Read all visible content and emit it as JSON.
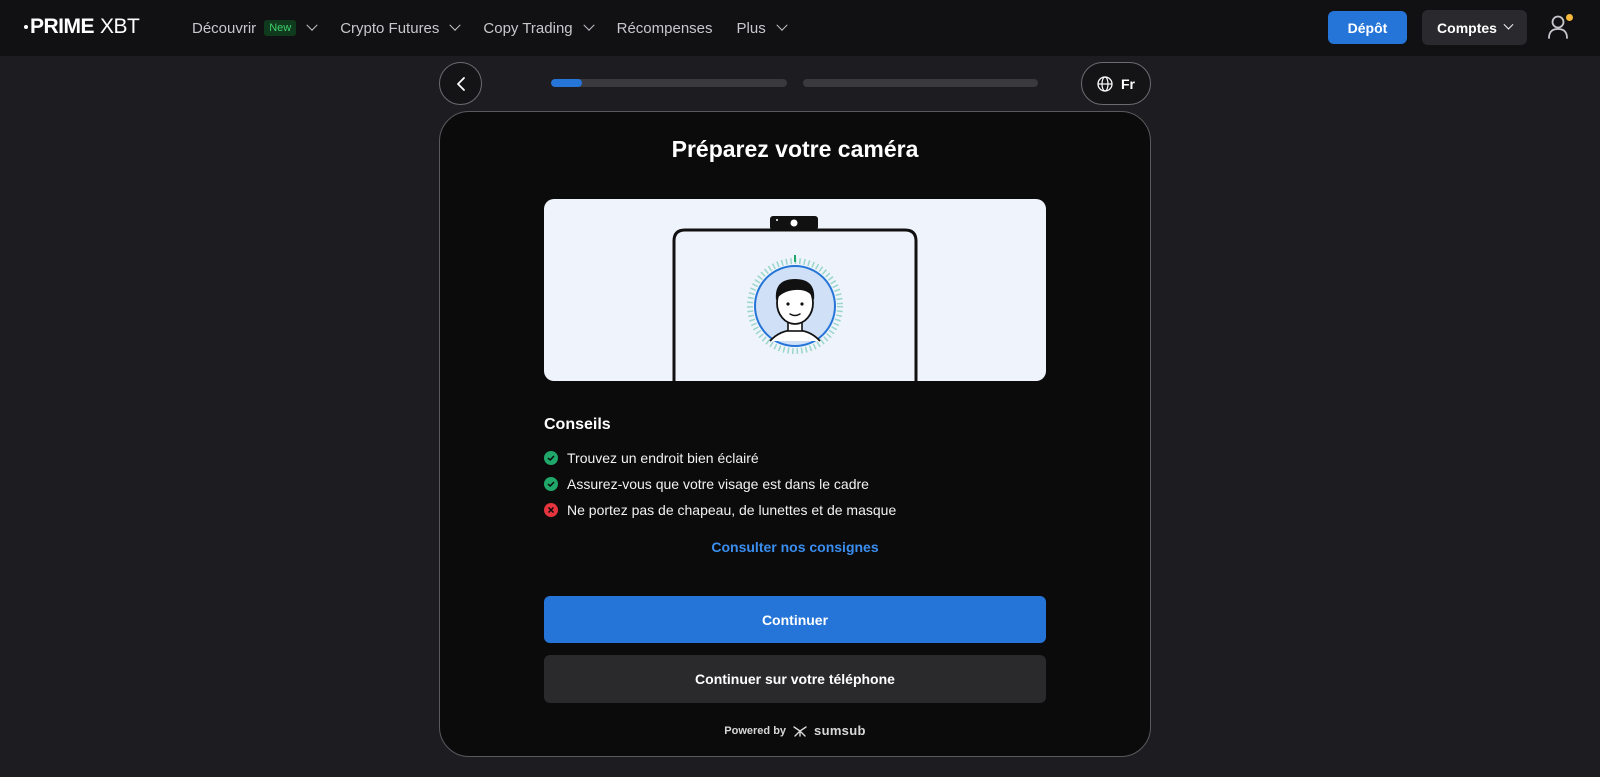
{
  "header": {
    "logo_prime": "PRIME",
    "logo_xbt": "XBT",
    "nav": [
      {
        "label": "Découvrir",
        "badge": "New",
        "has_dropdown": true
      },
      {
        "label": "Crypto Futures",
        "has_dropdown": true
      },
      {
        "label": "Copy Trading",
        "has_dropdown": true
      },
      {
        "label": "Récompenses",
        "has_dropdown": false
      },
      {
        "label": "Plus",
        "has_dropdown": true
      }
    ],
    "deposit_label": "Dépôt",
    "accounts_label": "Comptes",
    "accent_color": "#2575d8",
    "notification_color": "#f5b83a"
  },
  "stepper": {
    "language": "Fr",
    "step1_progress": 0.13,
    "step2_progress": 0
  },
  "card": {
    "title": "Préparez votre caméra",
    "tips_title": "Conseils",
    "tips": [
      {
        "text": "Trouvez un endroit bien éclairé",
        "status": "ok"
      },
      {
        "text": "Assurez-vous que votre visage est dans le cadre",
        "status": "ok"
      },
      {
        "text": "Ne portez pas de chapeau, de lunettes et de masque",
        "status": "bad"
      }
    ],
    "guidelines_link": "Consulter nos consignes",
    "continue_label": "Continuer",
    "continue_phone_label": "Continuer sur votre téléphone",
    "powered_by": "Powered by",
    "powered_brand": "sumsub"
  }
}
